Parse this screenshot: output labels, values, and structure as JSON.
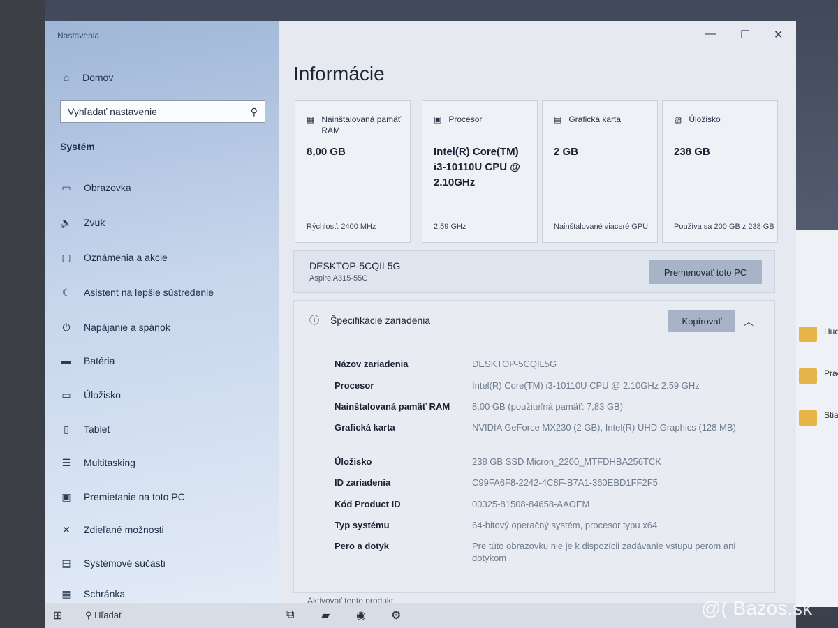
{
  "window": {
    "title": "Nastavenia"
  },
  "sidebar": {
    "home": "Domov",
    "search_placeholder": "Vyhľadať nastavenie",
    "section": "Systém",
    "items": [
      {
        "label": "Obrazovka",
        "icon": "monitor-icon"
      },
      {
        "label": "Zvuk",
        "icon": "speaker-icon"
      },
      {
        "label": "Oznámenia a akcie",
        "icon": "message-icon"
      },
      {
        "label": "Asistent na lepšie sústredenie",
        "icon": "moon-icon"
      },
      {
        "label": "Napájanie a spánok",
        "icon": "power-icon"
      },
      {
        "label": "Batéria",
        "icon": "battery-icon"
      },
      {
        "label": "Úložisko",
        "icon": "storage-icon"
      },
      {
        "label": "Tablet",
        "icon": "tablet-icon"
      },
      {
        "label": "Multitasking",
        "icon": "multitask-icon"
      },
      {
        "label": "Premietanie na toto PC",
        "icon": "project-icon"
      },
      {
        "label": "Zdieľané možnosti",
        "icon": "share-icon"
      },
      {
        "label": "Systémové súčasti",
        "icon": "components-icon"
      },
      {
        "label": "Schránka",
        "icon": "clipboard-icon"
      }
    ]
  },
  "main": {
    "title": "Informácie",
    "cards": [
      {
        "header": "Nainštalovaná pamäť RAM",
        "value": "8,00 GB",
        "footer": "Rýchlosť: 2400 MHz",
        "icon": "ram-icon"
      },
      {
        "header": "Procesor",
        "value": "Intel(R) Core(TM) i3-10110U CPU @ 2.10GHz",
        "footer": "2.59 GHz",
        "icon": "cpu-icon"
      },
      {
        "header": "Grafická karta",
        "value": "2 GB",
        "footer": "Nainštalované viaceré GPU",
        "icon": "gpu-icon"
      },
      {
        "header": "Úložisko",
        "value": "238 GB",
        "footer": "Používa sa 200 GB z 238 GB",
        "icon": "disk-icon"
      }
    ],
    "pc_name": "DESKTOP-5CQIL5G",
    "pc_model": "Aspire A315-55G",
    "rename_button": "Premenovať toto PC",
    "spec_title": "Špecifikácie zariadenia",
    "copy_button": "Kopírovať",
    "specs": [
      {
        "k": "Názov zariadenia",
        "v": "DESKTOP-5CQIL5G"
      },
      {
        "k": "Procesor",
        "v": "Intel(R) Core(TM) i3-10110U CPU @ 2.10GHz   2.59 GHz"
      },
      {
        "k": "Nainštalovaná pamäť RAM",
        "v": "8,00 GB (použiteľná pamäť: 7,83 GB)"
      },
      {
        "k": "Grafická karta",
        "v": "NVIDIA GeForce MX230 (2 GB), Intel(R) UHD Graphics (128 MB)"
      },
      {
        "k": "Úložisko",
        "v": "238 GB SSD Micron_2200_MTFDHBA256TCK"
      },
      {
        "k": "ID zariadenia",
        "v": "C99FA6F8-2242-4C8F-B7A1-360EBD1FF2F5"
      },
      {
        "k": "Kód Product ID",
        "v": "00325-81508-84658-AAOEM"
      },
      {
        "k": "Typ systému",
        "v": "64-bitový operačný systém, procesor typu x64"
      },
      {
        "k": "Pero a dotyk",
        "v": "Pre túto obrazovku nie je k dispozícii zadávanie vstupu perom ani dotykom"
      }
    ],
    "more": "Aktivovať tento produkt"
  },
  "taskbar": {
    "search": "Hľadať"
  },
  "desktop_right": [
    "Hud",
    "Prac",
    "Stiah"
  ],
  "watermark": "@( Bazos.sk"
}
